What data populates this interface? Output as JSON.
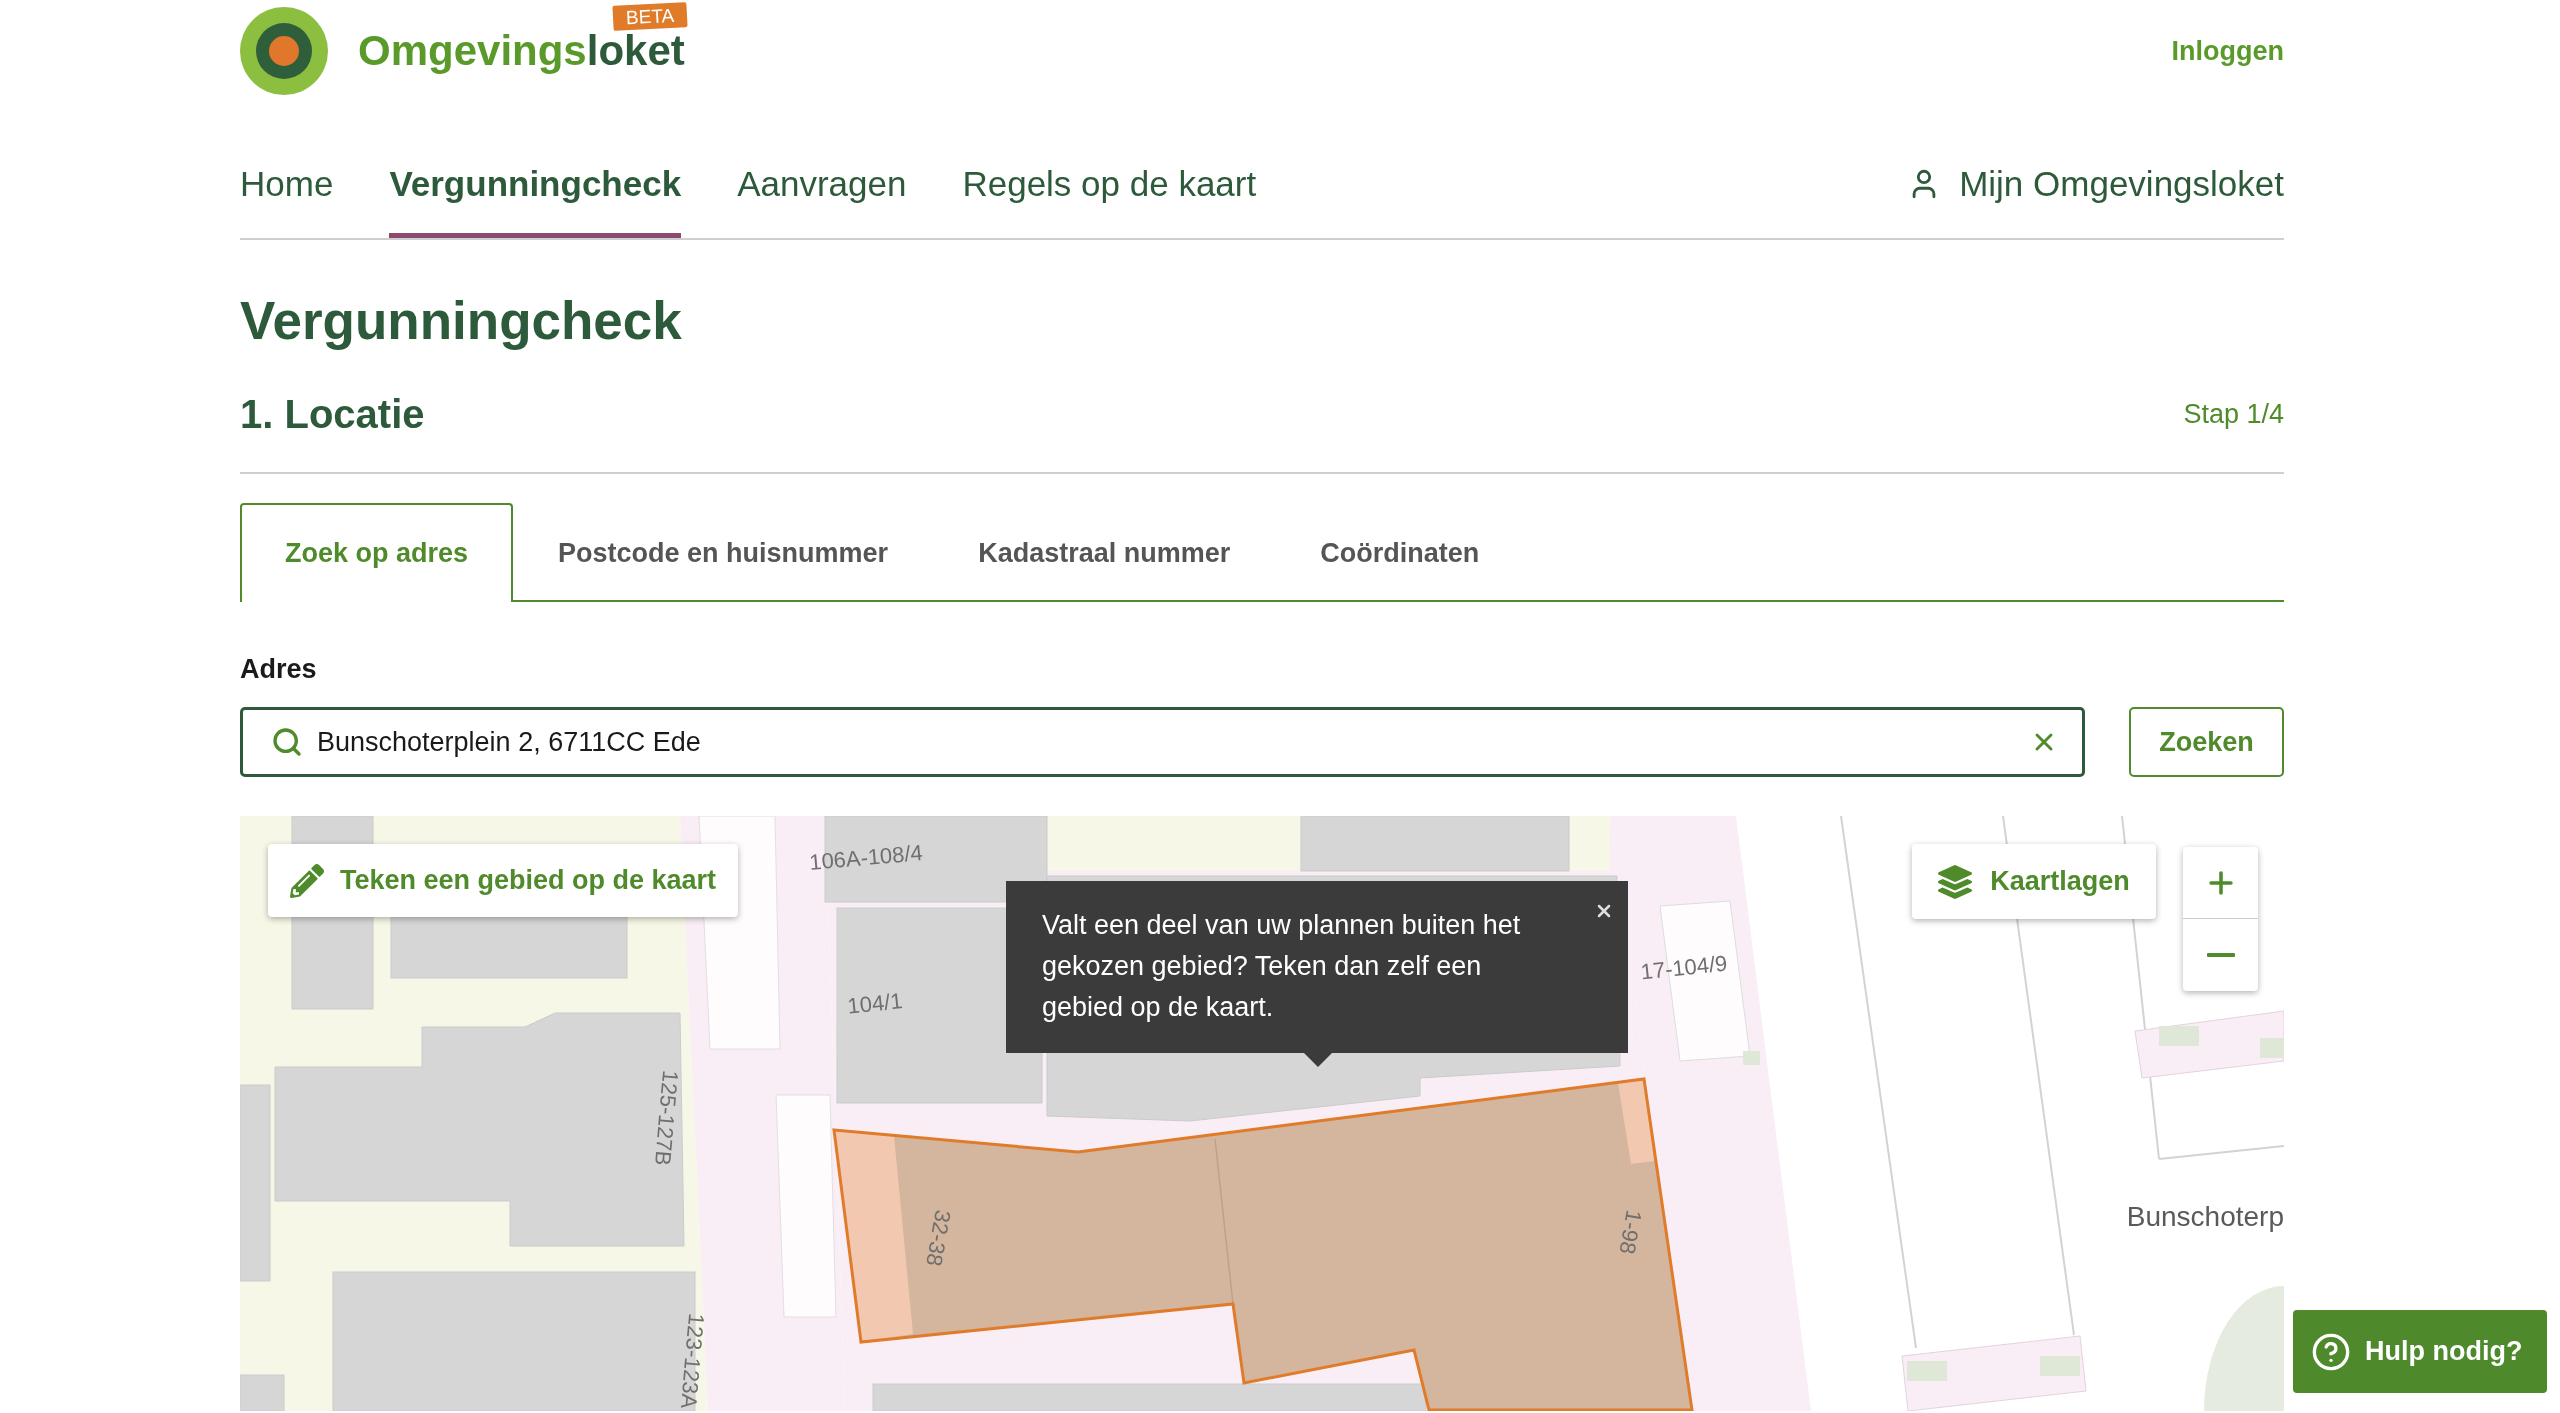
{
  "header": {
    "logo": {
      "prefix": "Omgevings",
      "suffix": "loket",
      "badge": "BETA"
    },
    "login_link": "Inloggen"
  },
  "nav": {
    "items": [
      {
        "label": "Home",
        "selected": false
      },
      {
        "label": "Vergunningcheck",
        "selected": true
      },
      {
        "label": "Aanvragen",
        "selected": false
      },
      {
        "label": "Regels op de kaart",
        "selected": false
      }
    ],
    "account_link": "Mijn Omgevingsloket"
  },
  "page": {
    "title": "Vergunningcheck",
    "step_title": "1. Locatie",
    "step_counter": "Stap 1/4"
  },
  "location_tabs": [
    {
      "label": "Zoek op adres",
      "selected": true
    },
    {
      "label": "Postcode en huisnummer",
      "selected": false
    },
    {
      "label": "Kadastraal nummer",
      "selected": false
    },
    {
      "label": "Coördinaten",
      "selected": false
    }
  ],
  "address": {
    "label": "Adres",
    "value": "Bunschoterplein 2, 6711CC Ede",
    "button": "Zoeken"
  },
  "map": {
    "draw_button": "Teken een gebied op de kaart",
    "layers_button": "Kaartlagen",
    "tooltip": "Valt een deel van uw plannen buiten het gekozen gebied? Teken dan zelf een gebied op de kaart.",
    "labels": [
      "106A-108/4",
      "104/1",
      "17-104/9",
      "125-127B",
      "123-123A",
      "32-38",
      "1-98",
      "Bunschoterp"
    ]
  },
  "help_button": "Hulp nodig?"
}
